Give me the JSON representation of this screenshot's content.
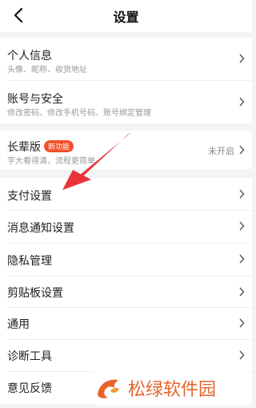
{
  "header": {
    "title": "设置",
    "back_icon": "chevron-left-icon"
  },
  "group1": [
    {
      "label": "个人信息",
      "sub": "头像、昵称、收货地址"
    },
    {
      "label": "账号与安全",
      "sub": "修改密码、修改手机号码、账号绑定管理"
    }
  ],
  "group2": {
    "label": "长辈版",
    "badge": "新功能",
    "sub": "字大看得清，流程更简单",
    "status": "未开启"
  },
  "group3": [
    {
      "label": "支付设置"
    },
    {
      "label": "消息通知设置"
    },
    {
      "label": "隐私管理"
    },
    {
      "label": "剪贴板设置"
    },
    {
      "label": "通用"
    },
    {
      "label": "诊断工具"
    },
    {
      "label": "意见反馈"
    }
  ],
  "annotation": {
    "arrow_color": "#e8343a"
  },
  "watermark": {
    "text": "松绿软件园",
    "color": "#e8632a"
  }
}
